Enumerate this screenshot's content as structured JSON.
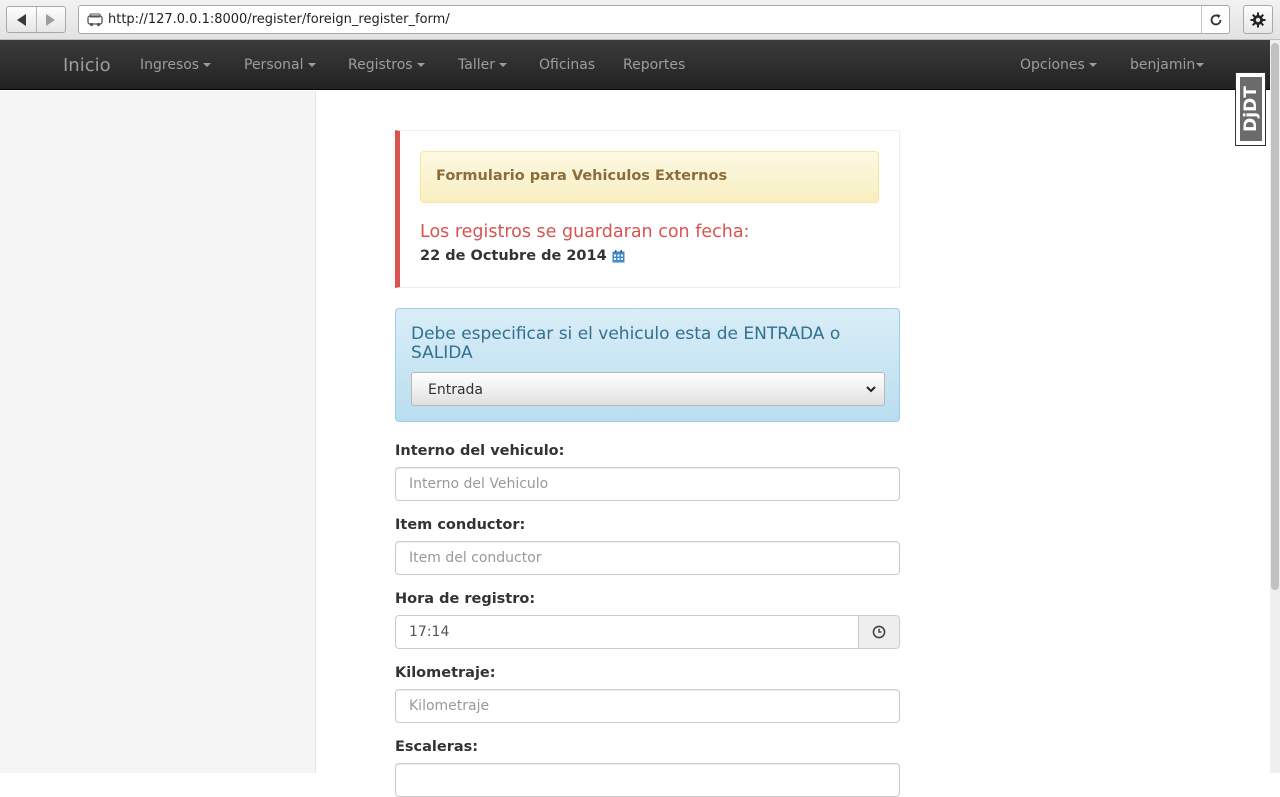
{
  "browser": {
    "url": "http://127.0.0.1:8000/register/foreign_register_form/"
  },
  "navbar": {
    "brand": "Inicio",
    "items": [
      {
        "label": "Ingresos",
        "dropdown": true
      },
      {
        "label": "Personal",
        "dropdown": true
      },
      {
        "label": "Registros",
        "dropdown": true
      },
      {
        "label": "Taller",
        "dropdown": true
      },
      {
        "label": "Oficinas",
        "dropdown": false
      },
      {
        "label": "Reportes",
        "dropdown": false
      }
    ],
    "right_items": [
      {
        "label": "Opciones",
        "dropdown": true
      },
      {
        "label": "benjamin",
        "dropdown": true
      }
    ]
  },
  "debug_toolbar": {
    "label": "DjDT"
  },
  "callout": {
    "warning": "Formulario para Vehiculos Externos",
    "heading": "Los registros se guardaran con fecha:",
    "date": "22 de Octubre de 2014"
  },
  "direction": {
    "title": "Debe especificar si el vehiculo esta de ENTRADA o SALIDA",
    "selected": "Entrada"
  },
  "form": {
    "interno": {
      "label": "Interno del vehiculo:",
      "placeholder": "Interno del Vehiculo"
    },
    "item": {
      "label": "Item conductor:",
      "placeholder": "Item del conductor"
    },
    "hora": {
      "label": "Hora de registro:",
      "value": "17:14"
    },
    "kilometraje": {
      "label": "Kilometraje:",
      "placeholder": "Kilometraje"
    },
    "escaleras": {
      "label": "Escaleras:"
    }
  },
  "colors": {
    "navbar_bg": "#222222",
    "danger": "#d9534f",
    "warning_text": "#8a6d3b",
    "info_text": "#31708f",
    "calendar_icon": "#428bca"
  }
}
